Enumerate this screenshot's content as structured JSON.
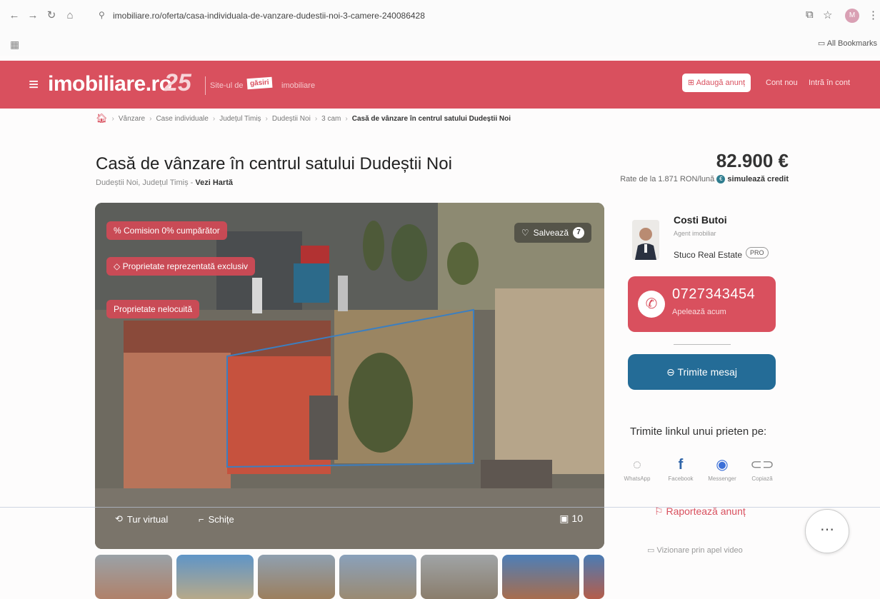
{
  "browser": {
    "url": "imobiliare.ro/oferta/casa-individuala-de-vanzare-dudestii-noi-3-camere-240086428",
    "bookmarks_label": "All Bookmarks",
    "profile_initial": "M"
  },
  "header": {
    "logo": "imobiliare.ro",
    "anniversary": "25",
    "tagline_before": "Site-ul de",
    "tagline_highlight": "găsiri",
    "tagline_after": "imobiliare",
    "add_listing": "Adaugă anunț",
    "create_account": "Cont nou",
    "login": "Intră în cont"
  },
  "breadcrumb": [
    "Vânzare",
    "Case individuale",
    "Județul Timiș",
    "Dudeștii Noi",
    "3 cam",
    "Casă de vânzare în centrul satului Dudeștii Noi"
  ],
  "listing": {
    "title": "Casă de vânzare în centrul satului Dudeștii Noi",
    "location": "Dudeștii Noi, Județul Timiș",
    "map_link": "Vezi Hartă",
    "price": "82.900 €",
    "rate_text": "Rate de la 1.871 RON/lună",
    "simulate": "simulează credit"
  },
  "photo": {
    "badges": [
      "Comision 0% cumpărător",
      "Proprietate reprezentată exclusiv",
      "Proprietate nelocuită"
    ],
    "save_label": "Salvează",
    "save_count": "7",
    "virtual_tour": "Tur virtual",
    "sketches": "Schițe",
    "photo_count": "10"
  },
  "agent": {
    "name": "Costi Butoi",
    "role": "Agent imobiliar",
    "agency": "Stuco Real Estate",
    "pro_badge": "PRO",
    "phone": "0727343454",
    "call_now": "Apelează acum",
    "send_message": "Trimite mesaj"
  },
  "share": {
    "title": "Trimite linkul unui prieten pe:",
    "items": [
      {
        "label": "WhatsApp",
        "icon": "whatsapp-icon"
      },
      {
        "label": "Facebook",
        "icon": "facebook-icon"
      },
      {
        "label": "Messenger",
        "icon": "messenger-icon"
      },
      {
        "label": "Copiază",
        "icon": "link-icon"
      }
    ]
  },
  "report": "Raportează anunț",
  "video_call": "Vizionare prin apel video",
  "colors": {
    "brand": "#d9505e",
    "message_button": "#246c97"
  }
}
